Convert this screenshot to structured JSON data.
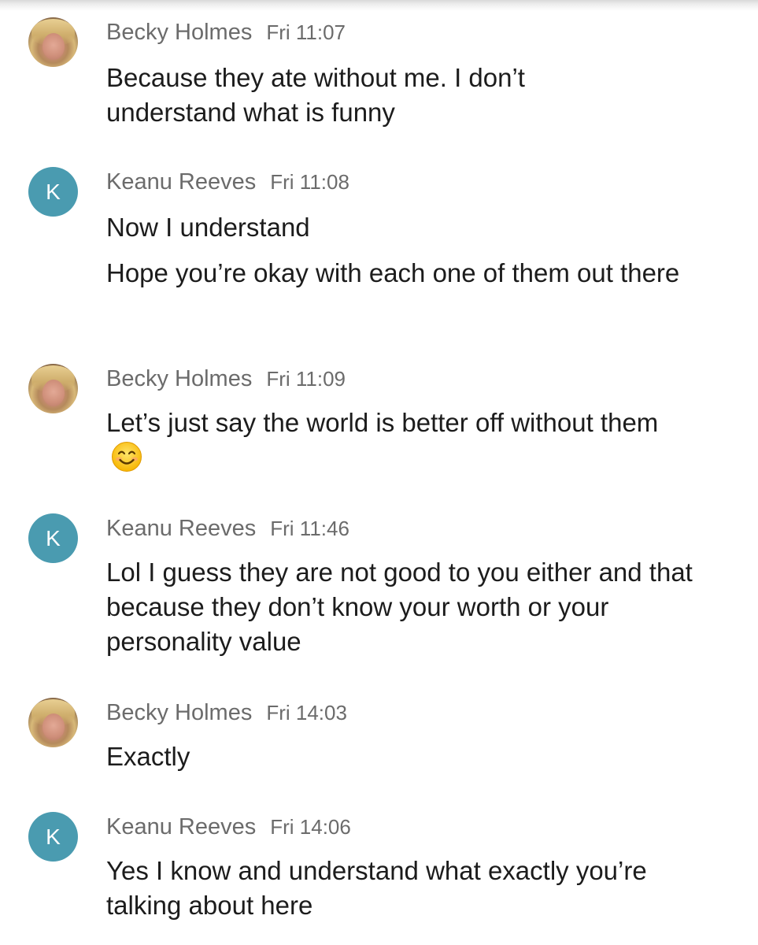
{
  "messages": [
    {
      "sender": "Becky Holmes",
      "time": "Fri 11:07",
      "avatar": "photo",
      "lines": [
        "Because they ate without me. I don’t understand what is funny"
      ]
    },
    {
      "sender": "Keanu Reeves",
      "time": "Fri 11:08",
      "avatar_letter": "K",
      "lines": [
        "Now I understand",
        "Hope you’re okay with each one of them out there"
      ]
    },
    {
      "sender": "Becky Holmes",
      "time": "Fri 11:09",
      "avatar": "photo",
      "lines": [
        "Let’s just say the world is better off without them"
      ],
      "emoji": "smiling-face-icon"
    },
    {
      "sender": "Keanu Reeves",
      "time": "Fri 11:46",
      "avatar_letter": "K",
      "lines": [
        "Lol I guess they are not good to you either and that because they don’t know your worth or your personality value"
      ]
    },
    {
      "sender": "Becky Holmes",
      "time": "Fri 14:03",
      "avatar": "photo",
      "lines": [
        "Exactly"
      ]
    },
    {
      "sender": "Keanu Reeves",
      "time": "Fri 14:06",
      "avatar_letter": "K",
      "lines": [
        "Yes I know and understand what exactly you’re talking about here"
      ]
    }
  ],
  "colors": {
    "avatar_letter_bg": "#4a9bb0",
    "meta_text": "#6b6b6b",
    "body_text": "#1c1c1c"
  }
}
